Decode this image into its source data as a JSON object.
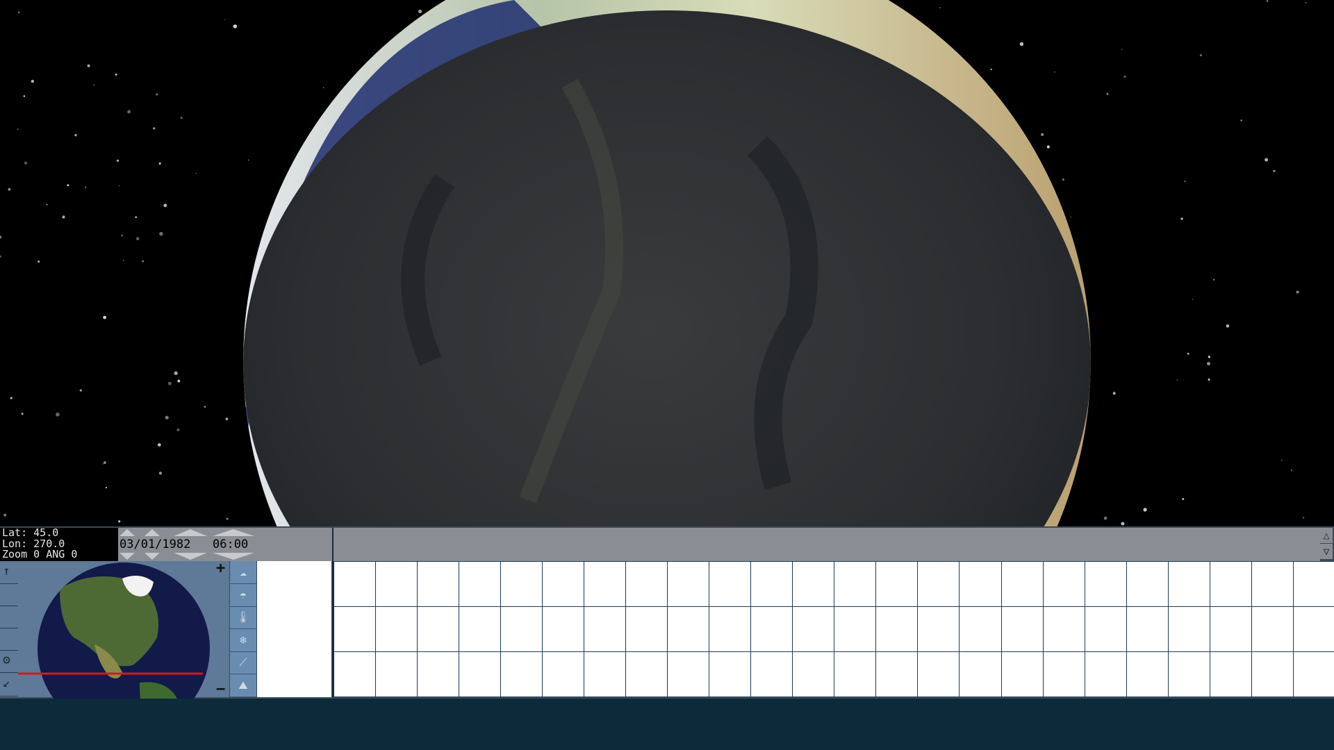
{
  "viewport": {
    "label": "3D globe view",
    "colors": {
      "space": "#000000",
      "night": "#2c2e31",
      "day_cloud": "#dfe3ea",
      "ocean": "#1a2a6c"
    }
  },
  "info": {
    "lat_label": "Lat:",
    "lat_value": "45.0",
    "lon_label": "Lon:",
    "lon_value": "270.0",
    "zoom_label": "Zoom",
    "zoom_value": "0",
    "ang_label": "ANG",
    "ang_value": "0"
  },
  "datetime": {
    "date": "03/01/1982",
    "time": "06:00"
  },
  "controls": {
    "zoom_in": "+",
    "zoom_out": "−",
    "scroll_up": "△",
    "scroll_down": "▽",
    "nav_up_icon": "arrow-up-icon",
    "nav_down_icon": "arrow-down-icon",
    "settings_icon": "gear-icon",
    "collapse_icon": "arrow-down-left-icon"
  },
  "weather_layers": [
    {
      "icon": "cloud-icon",
      "glyph": "☁"
    },
    {
      "icon": "rain-cloud-icon",
      "glyph": "☂"
    },
    {
      "icon": "thermometer-icon",
      "glyph": "🌡"
    },
    {
      "icon": "snowflake-icon",
      "glyph": "❄"
    },
    {
      "icon": "wind-icon",
      "glyph": "⟋"
    },
    {
      "icon": "terrain-icon",
      "glyph": "⛰"
    }
  ],
  "grid": {
    "rows": 3,
    "cols": 24
  }
}
